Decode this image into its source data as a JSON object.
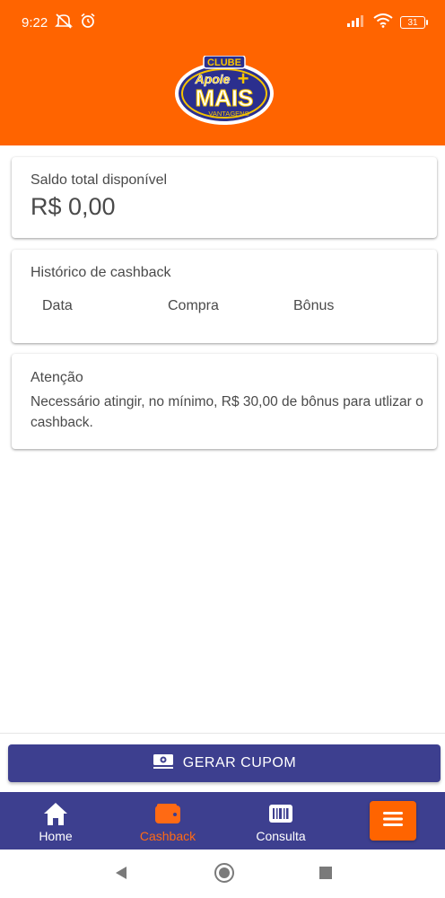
{
  "status_bar": {
    "time": "9:22",
    "battery": "31"
  },
  "logo": {
    "top_text": "CLUBE",
    "middle_text": "Apoie",
    "main_text": "MAIS",
    "bottom_text": "VANTAGENS"
  },
  "saldo": {
    "label": "Saldo total disponível",
    "value": "R$ 0,00"
  },
  "historico": {
    "title": "Histórico de cashback",
    "columns": [
      "Data",
      "Compra",
      "Bônus"
    ]
  },
  "atencao": {
    "title": "Atenção",
    "text": "Necessário atingir, no mínimo, R$ 30,00 de bônus para utlizar o cashback."
  },
  "gerar_cupom": {
    "label": "GERAR CUPOM"
  },
  "bottom_nav": {
    "home": "Home",
    "cashback": "Cashback",
    "consulta": "Consulta"
  },
  "colors": {
    "header": "#ff6400",
    "primary": "#3d3f8f",
    "active_tab": "#ff6a14"
  }
}
